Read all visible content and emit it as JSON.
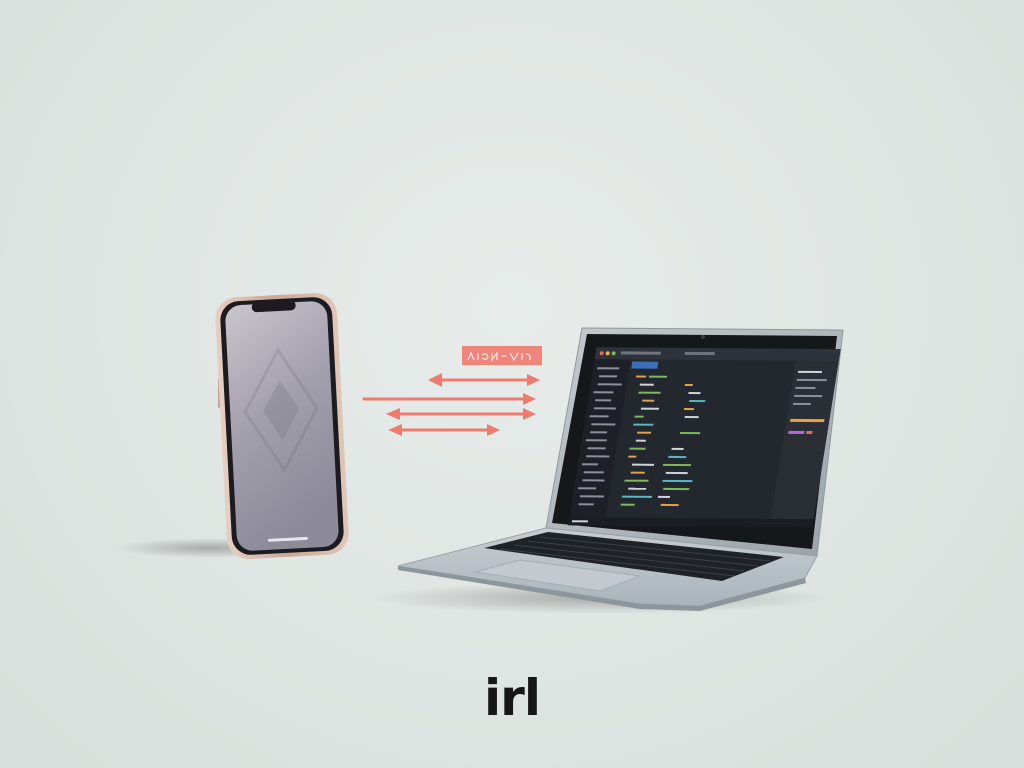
{
  "caption": "irl",
  "colors": {
    "background": "#dfe5e2",
    "accent_arrows": "#ef7a6e",
    "phone_frame": "#cdb0a0",
    "laptop_body": "#a8b1b6",
    "editor_bg": "#23272e",
    "code_green": "#7fb95b",
    "code_orange": "#e3a24a",
    "code_cyan": "#58b7c4"
  },
  "icons": {
    "phone_wallpaper": "diamond-logo-icon",
    "sync_arrows": "bidirectional-arrows-icon"
  }
}
